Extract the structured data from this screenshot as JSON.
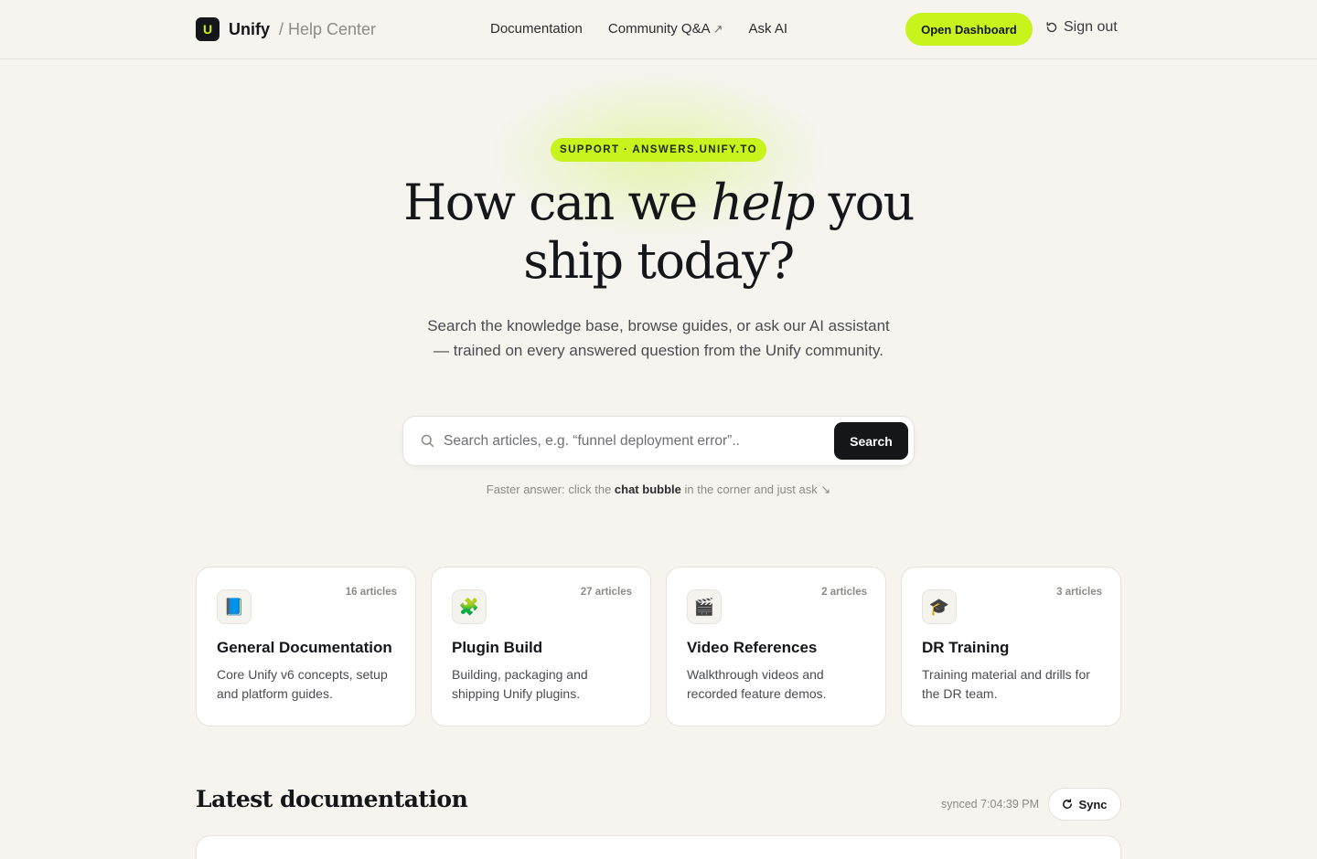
{
  "header": {
    "logo_letter": "U",
    "brand_name": "Unify",
    "brand_sub": "/ Help Center",
    "nav": [
      {
        "label": "Documentation"
      },
      {
        "label": "Community Q&A",
        "external_icon": "↗"
      },
      {
        "label": "Ask AI"
      }
    ],
    "dashboard_label": "Open Dashboard",
    "signout_label": "Sign out"
  },
  "hero": {
    "pill": "SUPPORT · ANSWERS.UNIFY.TO",
    "title_part1": "How can we ",
    "title_em": "help",
    "title_part2": " you ship today?",
    "subtitle": "Search the knowledge base, browse guides, or ask our AI assistant — trained on every answered question from the Unify community.",
    "search_placeholder": "Search articles, e.g. “funnel deployment error”..",
    "search_button": "Search",
    "hint_pre": "Faster answer: click the ",
    "hint_bold": "chat bubble",
    "hint_post": " in the corner and just ask ↘"
  },
  "categories": [
    {
      "icon": "📘",
      "icon_name": "book-icon",
      "count": "16 articles",
      "title": "General Documentation",
      "desc": "Core Unify v6 concepts, setup and platform guides."
    },
    {
      "icon": "🧩",
      "icon_name": "puzzle-icon",
      "count": "27 articles",
      "title": "Plugin Build",
      "desc": "Building, packaging and shipping Unify plugins."
    },
    {
      "icon": "🎬",
      "icon_name": "clapper-icon",
      "count": "2 articles",
      "title": "Video References",
      "desc": "Walkthrough videos and recorded feature demos."
    },
    {
      "icon": "🎓",
      "icon_name": "graduation-cap-icon",
      "count": "3 articles",
      "title": "DR Training",
      "desc": "Training material and drills for the DR team."
    }
  ],
  "latest": {
    "title": "Latest documentation",
    "synced": "synced 7:04:39 PM",
    "sync_label": "Sync"
  },
  "colors": {
    "accent": "#c8f31d",
    "background": "#f5f4ef",
    "ink": "#15161a"
  }
}
